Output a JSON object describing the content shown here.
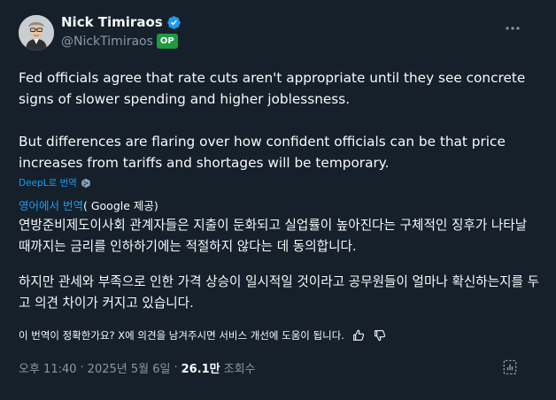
{
  "author": {
    "display_name": "Nick Timiraos",
    "handle": "@NickTimiraos",
    "badge": "OP",
    "verified": true
  },
  "tweet": {
    "paragraphs": [
      "Fed officials agree that rate cuts aren't appropriate until they see concrete signs of slower spending and higher joblessness.",
      "But differences are flaring over how confident officials can be that price increases from tariffs and shortages will be temporary."
    ]
  },
  "deepl": {
    "label": "DeepL로 번역"
  },
  "google_translation": {
    "link_label": "영어에서 번역",
    "credit": "( Google 제공)",
    "paragraphs": [
      "연방준비제도이사회 관계자들은 지출이 둔화되고 실업률이 높아진다는 구체적인 징후가 나타날 때까지는 금리를 인하하기에는 적절하지 않다는 데 동의합니다.",
      "하지만 관세와 부족으로 인한 가격 상승이 일시적일 것이라고 공무원들이 얼마나 확신하는지를 두고 의견 차이가 커지고 있습니다."
    ],
    "feedback_prompt": "이 번역이 정확한가요? X에 의견을 남겨주시면 서비스 개선에 도움이 됩니다."
  },
  "meta": {
    "time": "오후 11:40",
    "separator1": "·",
    "date": "2025년 5월 6일",
    "separator2": "·",
    "views_count": "26.1만",
    "views_label": "조회수"
  },
  "icons": {
    "verified": "verified-badge-icon",
    "more": "more-icon",
    "deepl": "deepl-icon",
    "thumbs_up": "thumbs-up-icon",
    "thumbs_down": "thumbs-down-icon",
    "analytics": "analytics-icon"
  },
  "colors": {
    "background": "#15202b",
    "text": "#f7f9f9",
    "muted": "#8b98a5",
    "link": "#1d9bf0",
    "op_badge": "#1d9b3f",
    "verified": "#1d9bf0"
  }
}
